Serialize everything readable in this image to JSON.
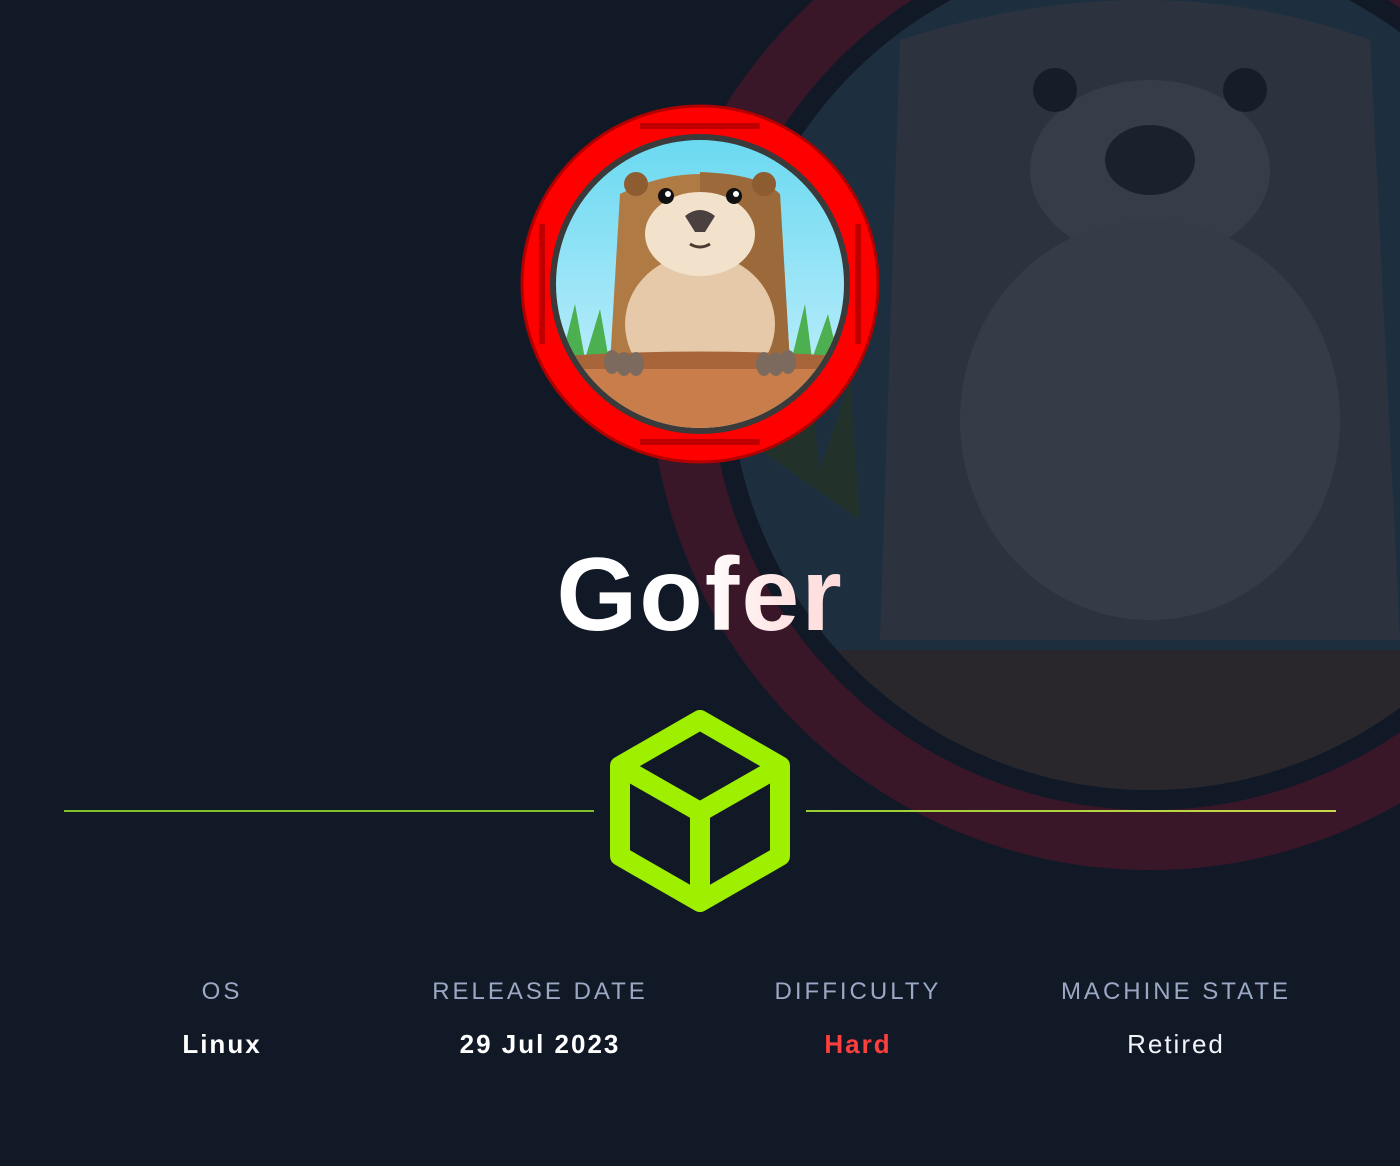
{
  "machine": {
    "name": "Gofer"
  },
  "stats": {
    "os": {
      "label": "OS",
      "value": "Linux"
    },
    "release_date": {
      "label": "RELEASE DATE",
      "value": "29 Jul 2023"
    },
    "difficulty": {
      "label": "DIFFICULTY",
      "value": "Hard"
    },
    "machine_state": {
      "label": "MACHINE STATE",
      "value": "Retired"
    }
  },
  "colors": {
    "background": "#111927",
    "accent_green": "#9fef00",
    "difficulty_hard": "#ff3e3e",
    "ring_red": "#ff0000",
    "label_gray": "#9ba8c3"
  },
  "icons": {
    "logo": "cube-icon",
    "avatar": "gopher-avatar"
  }
}
